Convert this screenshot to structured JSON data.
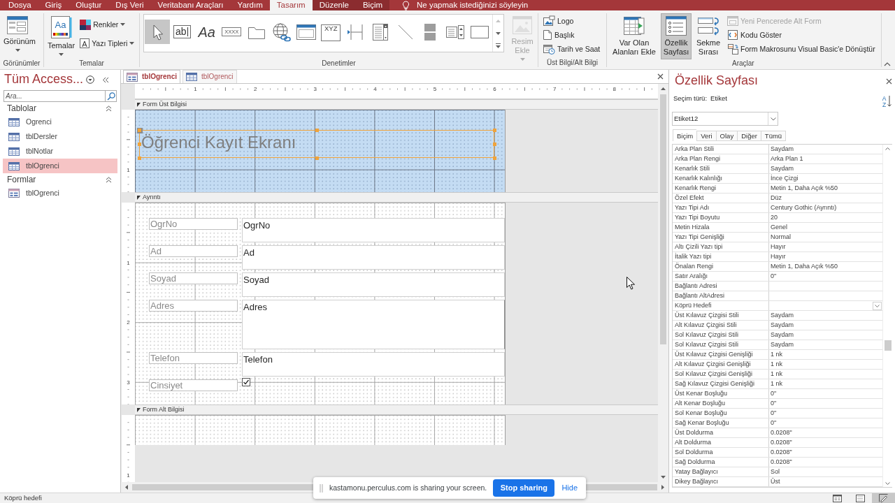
{
  "ribbon": {
    "tabs": [
      {
        "label": "Dosya",
        "selected": false,
        "kind": "main"
      },
      {
        "label": "Giriş",
        "selected": false,
        "kind": "main"
      },
      {
        "label": "Oluştur",
        "selected": false,
        "kind": "main"
      },
      {
        "label": "Dış Veri",
        "selected": false,
        "kind": "main"
      },
      {
        "label": "Veritabanı Araçları",
        "selected": false,
        "kind": "main"
      },
      {
        "label": "Yardım",
        "selected": false,
        "kind": "main"
      },
      {
        "label": "Tasarım",
        "selected": true,
        "kind": "contextual"
      },
      {
        "label": "Düzenle",
        "selected": false,
        "kind": "contextual"
      },
      {
        "label": "Biçim",
        "selected": false,
        "kind": "contextual"
      }
    ],
    "tell_me": "Ne yapmak istediğinizi söyleyin",
    "groups": [
      {
        "label": "Görünümler",
        "controls": [
          {
            "kind": "large",
            "label": "Görünüm",
            "dropdown": true,
            "disabled": false
          }
        ]
      },
      {
        "label": "Temalar",
        "controls": [
          {
            "kind": "large",
            "label": "Temalar",
            "dropdown": true,
            "disabled": false,
            "glyph": "Aa"
          },
          {
            "kind": "small",
            "label": "Renkler",
            "dropdown": true,
            "disabled": false
          },
          {
            "kind": "small",
            "label": "Yazı Tipleri",
            "dropdown": true,
            "disabled": false,
            "glyph": "A"
          }
        ]
      },
      {
        "label": "Denetimler",
        "gallery": [
          {
            "selected": true
          },
          {
            "selected": false,
            "glyph": "ab"
          },
          {
            "selected": false,
            "glyph": "Aa"
          },
          {
            "selected": false,
            "glyph": "XXXX"
          },
          {
            "selected": false
          },
          {
            "selected": false
          },
          {
            "selected": false
          },
          {
            "selected": false,
            "glyph": "XYZ"
          },
          {
            "selected": false
          },
          {
            "selected": false
          },
          {
            "selected": false
          },
          {
            "selected": false
          },
          {
            "selected": false
          },
          {
            "selected": false
          }
        ],
        "controls": [
          {
            "kind": "large",
            "label": "Resim Ekle",
            "dropdown": true,
            "disabled": true
          }
        ]
      },
      {
        "label": "Üst Bilgi/Alt Bilgi",
        "controls": [
          {
            "kind": "small",
            "label": "Logo",
            "dropdown": false,
            "disabled": false
          },
          {
            "kind": "small",
            "label": "Başlık",
            "dropdown": false,
            "disabled": false
          },
          {
            "kind": "small",
            "label": "Tarih ve Saat",
            "dropdown": false,
            "disabled": false
          }
        ]
      },
      {
        "label": "Araçlar",
        "controls": [
          {
            "kind": "large",
            "label": "Var Olan Alanları Ekle",
            "dropdown": false,
            "disabled": false,
            "selected": false
          },
          {
            "kind": "large",
            "label": "Özellik Sayfası",
            "dropdown": false,
            "disabled": false,
            "selected": true
          },
          {
            "kind": "large",
            "label": "Sekme Sırası",
            "dropdown": false,
            "disabled": false,
            "selected": false
          },
          {
            "kind": "small",
            "label": "Yeni Pencerede Alt Form",
            "dropdown": false,
            "disabled": true,
            "selected": false
          },
          {
            "kind": "small",
            "label": "Kodu Göster",
            "dropdown": false,
            "disabled": false,
            "selected": false
          },
          {
            "kind": "small",
            "label": "Form Makrosunu Visual Basic'e Dönüştür",
            "dropdown": false,
            "disabled": false,
            "selected": false
          }
        ]
      }
    ]
  },
  "navigation": {
    "title": "Tüm Access...",
    "search": {
      "placeholder": "Ara..."
    },
    "groups": [
      {
        "label": "Tablolar",
        "kind": "table",
        "expanded": true,
        "items": [
          {
            "label": "Ogrenci",
            "selected": false
          },
          {
            "label": "tblDersler",
            "selected": false
          },
          {
            "label": "tblNotlar",
            "selected": false
          },
          {
            "label": "tblOgrenci",
            "selected": true
          }
        ]
      },
      {
        "label": "Formlar",
        "kind": "form",
        "expanded": true,
        "items": [
          {
            "label": "tblOgrenci",
            "selected": false
          }
        ]
      }
    ]
  },
  "document": {
    "tabs": [
      {
        "label": "tblOgrenci",
        "kind": "form",
        "selected": true
      },
      {
        "label": "tblOgrenci",
        "kind": "table",
        "selected": false
      }
    ],
    "ruler": [
      "1",
      "2",
      "3",
      "4",
      "5",
      "6",
      "7",
      "8"
    ],
    "sections": [
      {
        "label": "Form Üst Bilgisi",
        "kind": "header",
        "ruler": [
          "1"
        ],
        "controls": [
          {
            "kind": "title",
            "text": "Öğrenci Kayıt Ekranı",
            "selected": true
          }
        ]
      },
      {
        "label": "Ayrıntı",
        "kind": "detail",
        "ruler": [
          "1",
          "2",
          "3"
        ],
        "controls": [
          {
            "kind": "textbox",
            "label": "OgrNo",
            "value": "OgrNo",
            "selected": false
          },
          {
            "kind": "textbox",
            "label": "Ad",
            "value": "Ad",
            "selected": false
          },
          {
            "kind": "textbox",
            "label": "Soyad",
            "value": "Soyad",
            "selected": false
          },
          {
            "kind": "textarea",
            "label": "Adres",
            "value": "Adres",
            "selected": false
          },
          {
            "kind": "textbox",
            "label": "Telefon",
            "value": "Telefon",
            "selected": false
          },
          {
            "kind": "checkbox",
            "label": "Cinsiyet",
            "checked": true,
            "selected": false
          }
        ]
      },
      {
        "label": "Form Alt Bilgisi",
        "kind": "footer",
        "ruler": [
          "1"
        ]
      }
    ]
  },
  "property_sheet": {
    "title": "Özellik Sayfası",
    "selection_label": "Seçim türü:",
    "selection_type": "Etiket",
    "sort_glyphs": [
      "A",
      "Z"
    ],
    "object": "Etiket12",
    "tabs": [
      {
        "label": "Biçim",
        "selected": true
      },
      {
        "label": "Veri",
        "selected": false
      },
      {
        "label": "Olay",
        "selected": false
      },
      {
        "label": "Diğer",
        "selected": false
      },
      {
        "label": "Tümü",
        "selected": false
      }
    ],
    "rows": [
      {
        "name": "Arka Plan Stili",
        "value": "Saydam",
        "kind": "text"
      },
      {
        "name": "Arka Plan Rengi",
        "value": "Arka Plan 1",
        "kind": "text"
      },
      {
        "name": "Kenarlık Stili",
        "value": "Saydam",
        "kind": "text"
      },
      {
        "name": "Kenarlık Kalınlığı",
        "value": "İnce Çizgi",
        "kind": "text"
      },
      {
        "name": "Kenarlık Rengi",
        "value": "Metin 1, Daha Açık %50",
        "kind": "text"
      },
      {
        "name": "Özel Efekt",
        "value": "Düz",
        "kind": "text"
      },
      {
        "name": "Yazı Tipi Adı",
        "value": "Century Gothic (Ayrıntı)",
        "kind": "text"
      },
      {
        "name": "Yazı Tipi Boyutu",
        "value": "20",
        "kind": "text"
      },
      {
        "name": "Metin Hizala",
        "value": "Genel",
        "kind": "text"
      },
      {
        "name": "Yazı Tipi Genişliği",
        "value": "Normal",
        "kind": "text"
      },
      {
        "name": "Altı Çizili Yazı tipi",
        "value": "Hayır",
        "kind": "text"
      },
      {
        "name": "İtalik Yazı tipi",
        "value": "Hayır",
        "kind": "text"
      },
      {
        "name": "Önalan Rengi",
        "value": "Metin 1, Daha Açık %50",
        "kind": "text"
      },
      {
        "name": "Satır Aralığı",
        "value": "0\"",
        "kind": "text"
      },
      {
        "name": "Bağlantı Adresi",
        "kind": "text"
      },
      {
        "name": "Bağlantı AltAdresi",
        "kind": "text"
      },
      {
        "name": "Köprü Hedefi",
        "kind": "dropdown"
      },
      {
        "name": "Üst Kılavuz Çizgisi Stili",
        "value": "Saydam",
        "kind": "text"
      },
      {
        "name": "Alt Kılavuz Çizgisi Stili",
        "value": "Saydam",
        "kind": "text"
      },
      {
        "name": "Sol Kılavuz Çizgisi Stili",
        "value": "Saydam",
        "kind": "text"
      },
      {
        "name": "Sol Kılavuz Çizgisi Stili",
        "value": "Saydam",
        "kind": "text"
      },
      {
        "name": "Üst Kılavuz Çizgisi Genişliği",
        "value": "1 nk",
        "kind": "text"
      },
      {
        "name": "Alt Kılavuz Çizgisi Genişliği",
        "value": "1 nk",
        "kind": "text"
      },
      {
        "name": "Sol Kılavuz Çizgisi Genişliği",
        "value": "1 nk",
        "kind": "text"
      },
      {
        "name": "Sağ Kılavuz Çizgisi Genişliği",
        "value": "1 nk",
        "kind": "text"
      },
      {
        "name": "Üst Kenar Boşluğu",
        "value": "0\"",
        "kind": "text"
      },
      {
        "name": "Alt Kenar Boşluğu",
        "value": "0\"",
        "kind": "text"
      },
      {
        "name": "Sol Kenar Boşluğu",
        "value": "0\"",
        "kind": "text"
      },
      {
        "name": "Sağ Kenar Boşluğu",
        "value": "0\"",
        "kind": "text"
      },
      {
        "name": "Üst Doldurma",
        "value": "0.0208\"",
        "kind": "text"
      },
      {
        "name": "Alt Doldurma",
        "value": "0.0208\"",
        "kind": "text"
      },
      {
        "name": "Sol Doldurma",
        "value": "0.0208\"",
        "kind": "text"
      },
      {
        "name": "Sağ Doldurma",
        "value": "0.0208\"",
        "kind": "text"
      },
      {
        "name": "Yatay Bağlayıcı",
        "value": "Sol",
        "kind": "text"
      },
      {
        "name": "Dikey Bağlayıcı",
        "value": "Üst",
        "kind": "text"
      }
    ]
  },
  "screen_share": {
    "message": "kastamonu.perculus.com is sharing your screen.",
    "stop": "Stop sharing",
    "hide": "Hide"
  },
  "status_bar": {
    "text": "Köprü hedefi",
    "views": [
      {
        "selected": false
      },
      {
        "selected": false
      },
      {
        "selected": true
      }
    ]
  }
}
